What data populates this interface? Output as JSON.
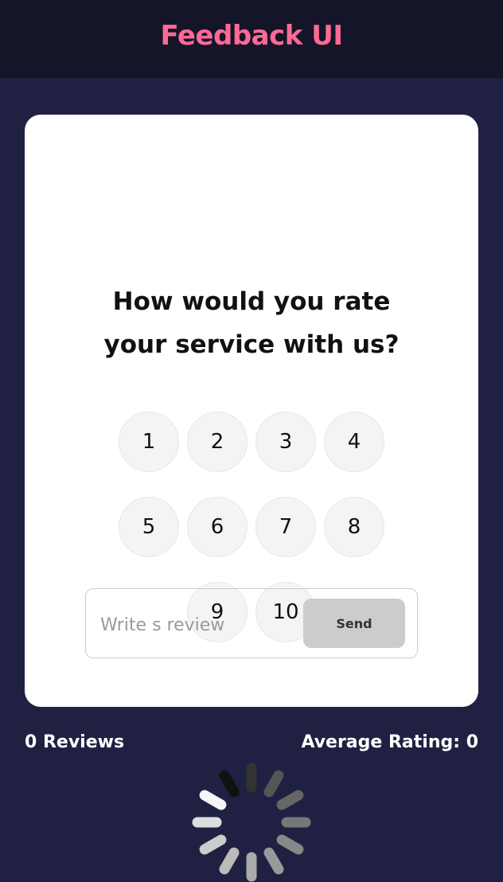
{
  "header": {
    "title": "Feedback UI"
  },
  "card": {
    "question_line1": "How would you rate",
    "question_line2": "your service with us?",
    "ratings": [
      "1",
      "2",
      "3",
      "4",
      "5",
      "6",
      "7",
      "8",
      "9",
      "10"
    ],
    "review_placeholder": "Write s review",
    "send_label": "Send"
  },
  "stats": {
    "reviews": "0 Reviews",
    "average": "Average Rating: 0"
  },
  "colors": {
    "brand": "#ff6a95",
    "background": "#202142",
    "header_bg": "#141529"
  },
  "icons": {
    "loading": "spinner-icon"
  }
}
